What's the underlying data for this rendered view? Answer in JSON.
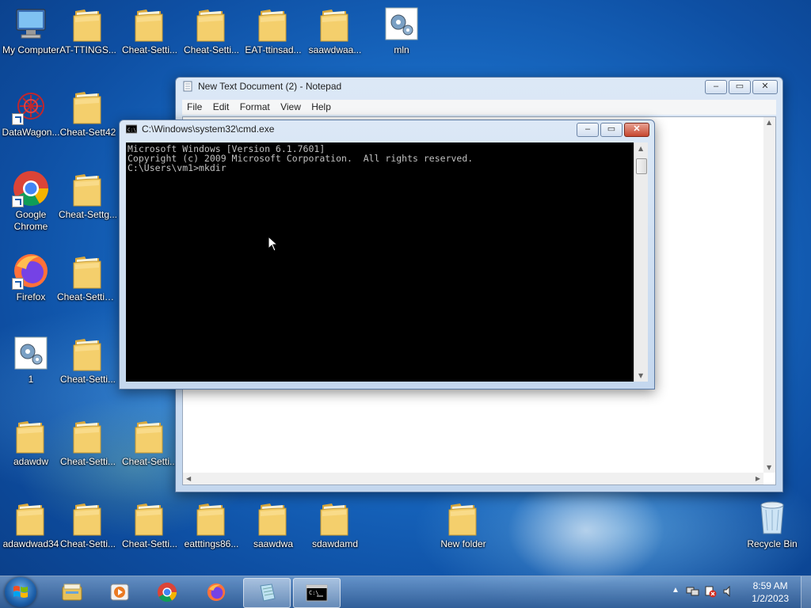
{
  "desktop": {
    "icons": [
      {
        "label": "My Computer",
        "kind": "computer"
      },
      {
        "label": "AT-TTINGS...",
        "kind": "folder"
      },
      {
        "label": "Cheat-Setti...",
        "kind": "folder"
      },
      {
        "label": "Cheat-Setti...",
        "kind": "folder"
      },
      {
        "label": "EAT-ttinsad...",
        "kind": "folder"
      },
      {
        "label": "saawdwaa...",
        "kind": "folder"
      },
      {
        "label": "mln",
        "kind": "settings"
      },
      {
        "label": "DataWagon...",
        "kind": "datawagon"
      },
      {
        "label": "Cheat-Sett42",
        "kind": "folder"
      },
      {
        "label": "Google Chrome",
        "kind": "chrome"
      },
      {
        "label": "Cheat-Settg...",
        "kind": "folder"
      },
      {
        "label": "Firefox",
        "kind": "firefox"
      },
      {
        "label": "Cheat-Settings",
        "kind": "folder"
      },
      {
        "label": "1",
        "kind": "settings"
      },
      {
        "label": "Cheat-Setti...",
        "kind": "folder"
      },
      {
        "label": "adawdw",
        "kind": "folder"
      },
      {
        "label": "Cheat-Setti...",
        "kind": "folder"
      },
      {
        "label": "Cheat-Setti...",
        "kind": "folder"
      },
      {
        "label": "adawdwad34",
        "kind": "folder"
      },
      {
        "label": "Cheat-Setti...",
        "kind": "folder"
      },
      {
        "label": "Cheat-Setti...",
        "kind": "folder"
      },
      {
        "label": "eatttings86...",
        "kind": "folder"
      },
      {
        "label": "saawdwa",
        "kind": "folder"
      },
      {
        "label": "sdawdamd",
        "kind": "folder"
      },
      {
        "label": "New folder",
        "kind": "folder"
      },
      {
        "label": "Recycle Bin",
        "kind": "recycle"
      }
    ]
  },
  "notepad": {
    "title": "New Text Document (2) - Notepad",
    "menu": [
      "File",
      "Edit",
      "Format",
      "View",
      "Help"
    ],
    "content": ""
  },
  "cmd": {
    "title": "C:\\Windows\\system32\\cmd.exe",
    "lines": [
      "Microsoft Windows [Version 6.1.7601]",
      "Copyright (c) 2009 Microsoft Corporation.  All rights reserved.",
      "",
      "C:\\Users\\vm1>mkdir"
    ]
  },
  "window_controls": {
    "minimize": "–",
    "maximize": "▭",
    "close": "✕"
  },
  "taskbar": {
    "items": [
      "explorer",
      "media-player",
      "chrome",
      "firefox",
      "notepad",
      "cmd"
    ],
    "active": [
      "notepad",
      "cmd"
    ],
    "clock_time": "8:59 AM",
    "clock_date": "1/2/2023"
  }
}
